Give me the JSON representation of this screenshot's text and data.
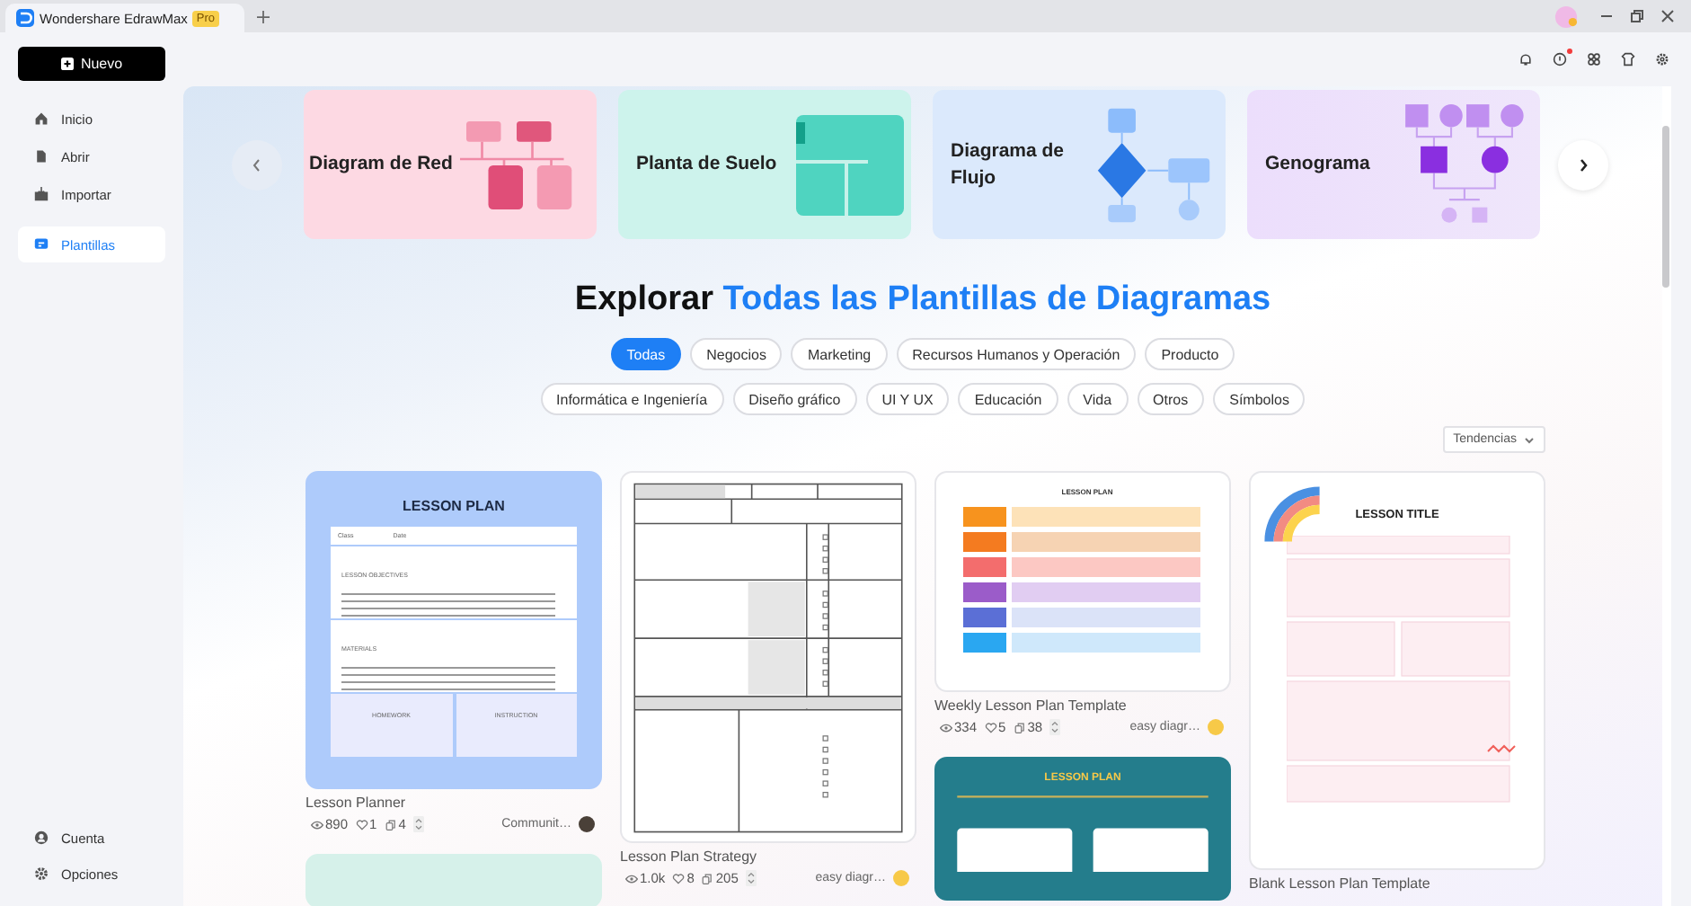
{
  "app": {
    "title": "Wondershare EdrawMax",
    "badge": "Pro"
  },
  "sidebar": {
    "new_button": "Nuevo",
    "items": [
      {
        "label": "Inicio",
        "selected": false
      },
      {
        "label": "Abrir",
        "selected": false
      },
      {
        "label": "Importar",
        "selected": false
      },
      {
        "label": "Plantillas",
        "selected": true
      }
    ],
    "bottom_items": [
      {
        "label": "Cuenta"
      },
      {
        "label": "Opciones"
      }
    ]
  },
  "toolbar": {
    "help_notification": true
  },
  "banner": [
    {
      "title": "Diagram de Red",
      "kind": "network"
    },
    {
      "title": "Planta de Suelo",
      "kind": "floor"
    },
    {
      "title": "Diagrama de Flujo",
      "kind": "flow"
    },
    {
      "title": "Genograma",
      "kind": "genogram"
    }
  ],
  "heading": {
    "plain": "Explorar",
    "accent": "Todas las Plantillas de Diagramas"
  },
  "category_rows": [
    [
      {
        "label": "Todas",
        "selected": true
      },
      {
        "label": "Negocios",
        "selected": false
      },
      {
        "label": "Marketing",
        "selected": false
      },
      {
        "label": "Recursos Humanos y Operación",
        "selected": false
      },
      {
        "label": "Producto",
        "selected": false
      }
    ],
    [
      {
        "label": "Informática e Ingeniería",
        "selected": false
      },
      {
        "label": "Diseño gráfico",
        "selected": false
      },
      {
        "label": "UI Y UX",
        "selected": false
      },
      {
        "label": "Educación",
        "selected": false
      },
      {
        "label": "Vida",
        "selected": false
      },
      {
        "label": "Otros",
        "selected": false
      },
      {
        "label": "Símbolos",
        "selected": false
      }
    ]
  ],
  "sort": "Tendencias",
  "template_columns": [
    [
      {
        "title": "Lesson Planner",
        "views": "890",
        "likes": "1",
        "copies": "4",
        "author": "Communit…",
        "thumb": {
          "kind": "planner",
          "heading": "LESSON PLAN",
          "labels": [
            "Class",
            "Date",
            "LESSON OBJECTIVES",
            "MATERIALS",
            "HOMEWORK",
            "INSTRUCTION"
          ]
        }
      },
      {
        "thumb": {
          "kind": "mint"
        }
      }
    ],
    [
      {
        "title": "Lesson Plan Strategy",
        "views": "1.0k",
        "likes": "8",
        "copies": "205",
        "author": "easy diagr…",
        "thumb": {
          "kind": "strategy"
        }
      }
    ],
    [
      {
        "title": "Weekly Lesson Plan Template",
        "views": "334",
        "likes": "5",
        "copies": "38",
        "author": "easy diagr…",
        "thumb": {
          "kind": "weekly",
          "heading": "LESSON PLAN"
        }
      },
      {
        "thumb": {
          "kind": "teal",
          "heading": "LESSON PLAN"
        }
      }
    ],
    [
      {
        "title": "Blank Lesson Plan Template",
        "thumb": {
          "kind": "blank",
          "heading": "LESSON TITLE"
        }
      }
    ]
  ]
}
